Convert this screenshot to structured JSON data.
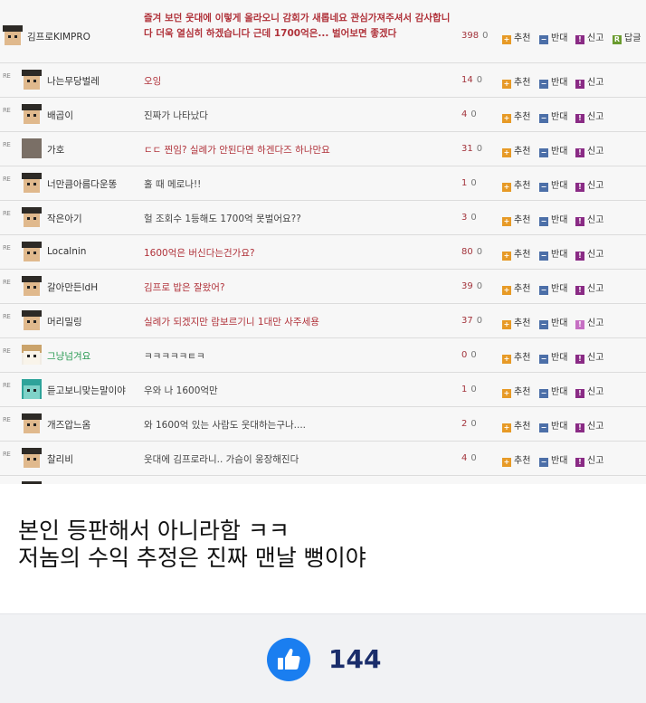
{
  "comments": {
    "rows": [
      {
        "nick": "김프로KIMPRO",
        "text": "즐겨 보던 웃대에 이렇게 올라오니 감회가 새롭네요 관심가져주셔서 감사합니다 더욱 열심히 하겠습니다 근데 1700억은... 벌어보면 좋겠다",
        "up": "398",
        "down": "0"
      },
      {
        "nick": "나는무당벌레",
        "text": "오잉",
        "up": "14",
        "down": "0"
      },
      {
        "nick": "배곱이",
        "text": "진짜가 나타났다",
        "up": "4",
        "down": "0"
      },
      {
        "nick": "가호",
        "text": "ㄷㄷ 찐임? 실례가 안된다면 하겐다즈 하나만요",
        "up": "31",
        "down": "0"
      },
      {
        "nick": "너만큼아름다운똥",
        "text": "홀 때 메로나!!",
        "up": "1",
        "down": "0"
      },
      {
        "nick": "작은아기",
        "text": "헐 조회수 1등해도 1700억 못벌어요??",
        "up": "3",
        "down": "0"
      },
      {
        "nick": "Localnin",
        "text": "1600억은 버신다는건가요?",
        "up": "80",
        "down": "0"
      },
      {
        "nick": "갈아만든ldH",
        "text": "김프로 밥은 잘왔어?",
        "up": "39",
        "down": "0"
      },
      {
        "nick": "머리밀링",
        "text": "실례가 되겠지만 람보르기니 1대만 사주세용",
        "up": "37",
        "down": "0"
      },
      {
        "nick": "그냥넘겨요",
        "text": "ㅋㅋㅋㅋㅋㅌㅋ",
        "up": "0",
        "down": "0"
      },
      {
        "nick": "듣고보니맞는말이야",
        "text": "우와 나 1600억만",
        "up": "1",
        "down": "0"
      },
      {
        "nick": "개즈압느옴",
        "text": "와 1600억 있는 사람도 웃대하는구나....",
        "up": "2",
        "down": "0"
      },
      {
        "nick": "찰리비",
        "text": "웃대에 김프로라니.. 가슴이 웅장해진다",
        "up": "4",
        "down": "0"
      }
    ],
    "re_tag": "RE",
    "recommend_label": "추천",
    "oppose_label": "반대",
    "report_label": "신고",
    "reply_label": "답글"
  },
  "caption": {
    "line1": "본인 등판해서 아니라함 ㅋㅋ",
    "line2": "저놈의 수익 추정은 진짜 맨날 뻥이야"
  },
  "like_bar": {
    "count": "144",
    "icon": "thumbs-up-icon",
    "accent_color": "#1a7ef0"
  },
  "colors": {
    "recommend": "#e79a26",
    "oppose": "#4c6fa8",
    "report": "#8a2b85",
    "reply": "#6a9b2f",
    "highlight_text": "#b0323a"
  }
}
